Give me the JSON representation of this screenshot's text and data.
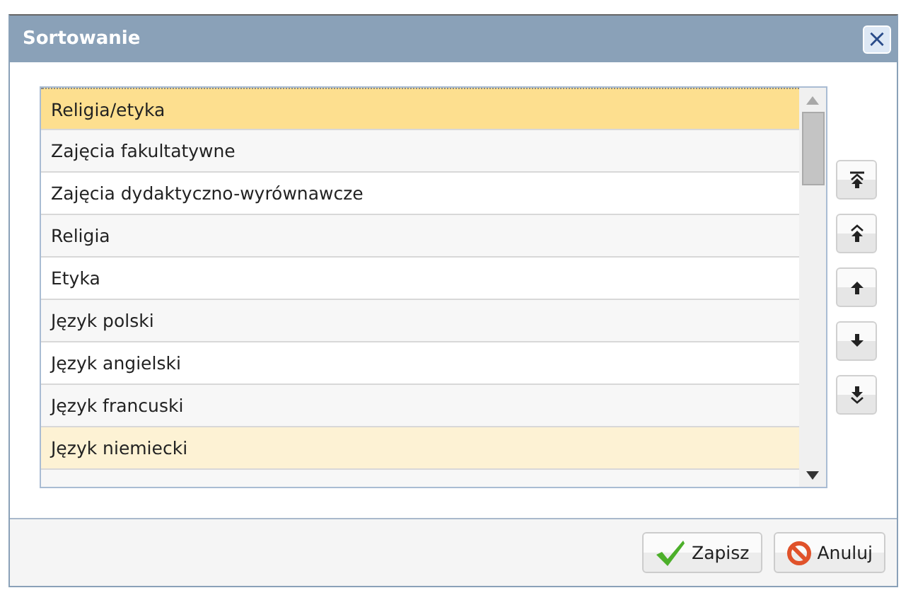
{
  "window": {
    "title": "Sortowanie",
    "close": "×"
  },
  "list": {
    "rows": [
      {
        "label": "Religia/etyka",
        "selected": true,
        "hovered": false
      },
      {
        "label": "Zajęcia fakultatywne",
        "selected": false,
        "hovered": false
      },
      {
        "label": "Zajęcia dydaktyczno-wyrównawcze",
        "selected": false,
        "hovered": false
      },
      {
        "label": "Religia",
        "selected": false,
        "hovered": false
      },
      {
        "label": "Etyka",
        "selected": false,
        "hovered": false
      },
      {
        "label": "Język polski",
        "selected": false,
        "hovered": false
      },
      {
        "label": "Język angielski",
        "selected": false,
        "hovered": false
      },
      {
        "label": "Język francuski",
        "selected": false,
        "hovered": false
      },
      {
        "label": "Język niemiecki",
        "selected": false,
        "hovered": true
      }
    ]
  },
  "move_buttons": [
    {
      "kind": "top"
    },
    {
      "kind": "page-up"
    },
    {
      "kind": "up"
    },
    {
      "kind": "down"
    },
    {
      "kind": "bottom"
    }
  ],
  "buttons": [
    {
      "kind": "save",
      "label": "Zapisz"
    },
    {
      "kind": "cancel",
      "label": "Anuluj"
    }
  ]
}
